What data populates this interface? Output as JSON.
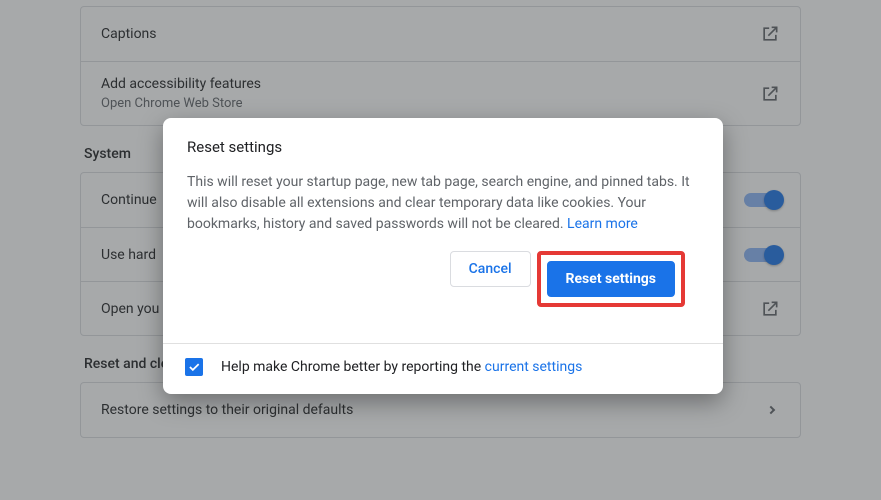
{
  "accessibility_card": {
    "captions": "Captions",
    "add_features_title": "Add accessibility features",
    "add_features_sub": "Open Chrome Web Store"
  },
  "system": {
    "heading": "System",
    "continue": "Continue",
    "hardware": "Use hard",
    "open": "Open you"
  },
  "reset_section": {
    "heading": "Reset and clean up",
    "restore": "Restore settings to their original defaults"
  },
  "dialog": {
    "title": "Reset settings",
    "body": "This will reset your startup page, new tab page, search engine, and pinned tabs. It will also disable all extensions and clear temporary data like cookies. Your bookmarks, history and saved passwords will not be cleared. ",
    "learn_more": "Learn more",
    "cancel": "Cancel",
    "confirm": "Reset settings",
    "help_prefix": "Help make Chrome better by reporting the ",
    "help_link": "current settings",
    "help_checked": true
  }
}
